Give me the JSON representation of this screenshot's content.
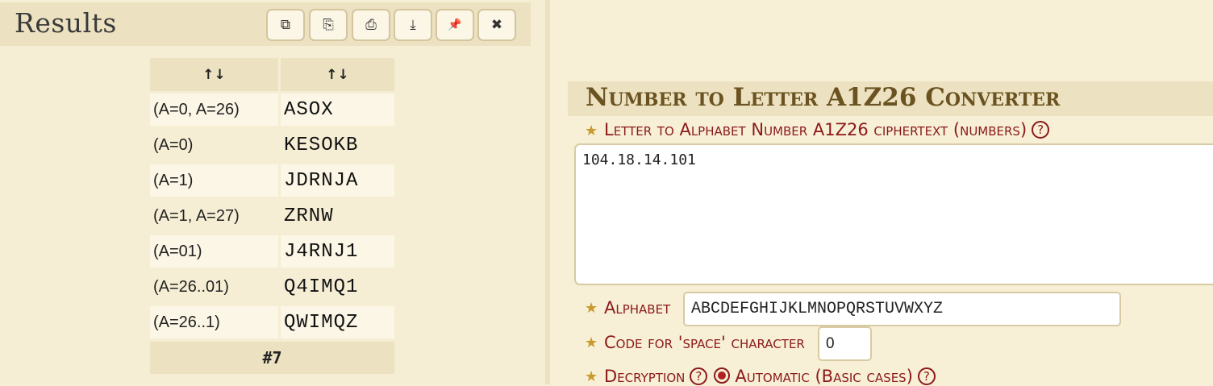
{
  "results": {
    "title": "Results",
    "toolbar": [
      {
        "name": "copy-button",
        "icon": "copy-icon",
        "glyph": "⧉"
      },
      {
        "name": "export-button",
        "icon": "share-icon",
        "glyph": "⎘"
      },
      {
        "name": "print-button",
        "icon": "print-icon",
        "glyph": "⎙"
      },
      {
        "name": "download-button",
        "icon": "download-icon",
        "glyph": "⤓"
      },
      {
        "name": "pin-button",
        "icon": "pin-icon",
        "glyph": "📌"
      },
      {
        "name": "close-button",
        "icon": "close-icon",
        "glyph": "✖"
      }
    ],
    "table": {
      "headers": [
        "↑↓",
        "↑↓"
      ],
      "rows": [
        {
          "mode": "(A=0, A=26)",
          "text": "ASOX"
        },
        {
          "mode": "(A=0)",
          "text": "KESOKB"
        },
        {
          "mode": "(A=1)",
          "text": "JDRNJA"
        },
        {
          "mode": "(A=1, A=27)",
          "text": "ZRNW"
        },
        {
          "mode": "(A=01)",
          "text": "J4RNJ1"
        },
        {
          "mode": "(A=26..01)",
          "text": "Q4IMQ1"
        },
        {
          "mode": "(A=26..1)",
          "text": "QWIMQZ"
        }
      ],
      "footer": "#7"
    }
  },
  "converter": {
    "title": "Number to Letter A1Z26 Converter",
    "ciphertext_label": "Letter to Alphabet Number A1Z26 ciphertext (numbers)",
    "ciphertext_value": "104.18.14.101",
    "alphabet_label": "Alphabet",
    "alphabet_value": "ABCDEFGHIJKLMNOPQRSTUVWXYZ",
    "space_label": "Code for 'space' character",
    "space_value": "0",
    "decryption_label": "Decryption",
    "decryption_option": "Automatic (Basic cases)",
    "help_glyph": "?"
  },
  "colors": {
    "background": "#f7efd6",
    "header_band": "#ece1c0",
    "label_red": "#8b1a1a",
    "title_brown": "#6a5320",
    "star_gold": "#c99a2e"
  }
}
